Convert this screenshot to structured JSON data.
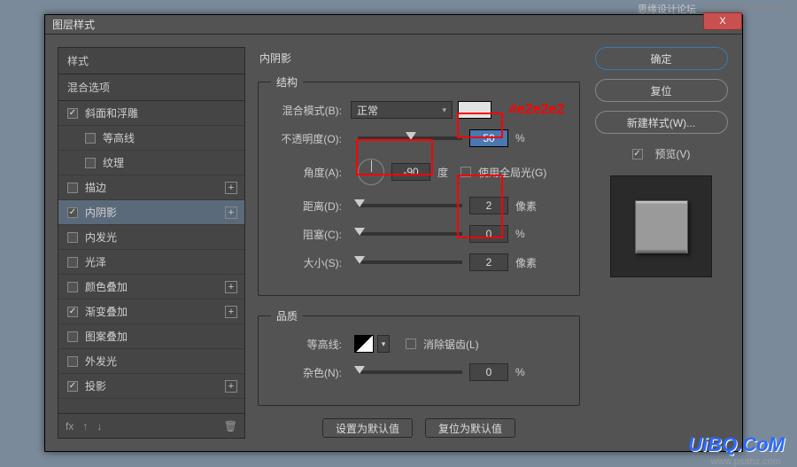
{
  "window": {
    "title": "图层样式"
  },
  "top": {
    "credit": "思缘设计论坛",
    "site": "WWW.MISSYUAN.COM"
  },
  "sidebar": {
    "header": "样式",
    "subheader": "混合选项",
    "items": [
      {
        "label": "斜面和浮雕",
        "checked": true,
        "plus": false,
        "indent": false
      },
      {
        "label": "等高线",
        "checked": false,
        "plus": false,
        "indent": true
      },
      {
        "label": "纹理",
        "checked": false,
        "plus": false,
        "indent": true
      },
      {
        "label": "描边",
        "checked": false,
        "plus": true,
        "indent": false
      },
      {
        "label": "内阴影",
        "checked": true,
        "plus": true,
        "indent": false,
        "active": true
      },
      {
        "label": "内发光",
        "checked": false,
        "plus": false,
        "indent": false
      },
      {
        "label": "光泽",
        "checked": false,
        "plus": false,
        "indent": false
      },
      {
        "label": "颜色叠加",
        "checked": false,
        "plus": true,
        "indent": false
      },
      {
        "label": "渐变叠加",
        "checked": true,
        "plus": true,
        "indent": false
      },
      {
        "label": "图案叠加",
        "checked": false,
        "plus": false,
        "indent": false
      },
      {
        "label": "外发光",
        "checked": false,
        "plus": false,
        "indent": false
      },
      {
        "label": "投影",
        "checked": true,
        "plus": true,
        "indent": false
      }
    ],
    "footer_fx": "fx"
  },
  "main": {
    "title": "内阴影",
    "sections": {
      "structure": {
        "legend": "结构",
        "blend_label": "混合模式(B):",
        "blend_value": "正常",
        "hex_note": "#e2e2e2",
        "opacity_label": "不透明度(O):",
        "opacity_value": "50",
        "opacity_unit": "%",
        "angle_label": "角度(A):",
        "angle_value": "-90",
        "angle_unit": "度",
        "global_light_label": "使用全局光(G)",
        "distance_label": "距离(D):",
        "distance_value": "2",
        "distance_unit": "像素",
        "choke_label": "阻塞(C):",
        "choke_value": "0",
        "choke_unit": "%",
        "size_label": "大小(S):",
        "size_value": "2",
        "size_unit": "像素"
      },
      "quality": {
        "legend": "品质",
        "contour_label": "等高线:",
        "antialias_label": "消除锯齿(L)",
        "noise_label": "杂色(N):",
        "noise_value": "0",
        "noise_unit": "%"
      }
    },
    "buttons": {
      "make_default": "设置为默认值",
      "reset_default": "复位为默认值"
    }
  },
  "right": {
    "ok": "确定",
    "reset": "复位",
    "new_style": "新建样式(W)...",
    "preview_label": "预览(V)"
  },
  "watermark": "UiBQ.CoM",
  "watermark2": "www.psahz.com"
}
